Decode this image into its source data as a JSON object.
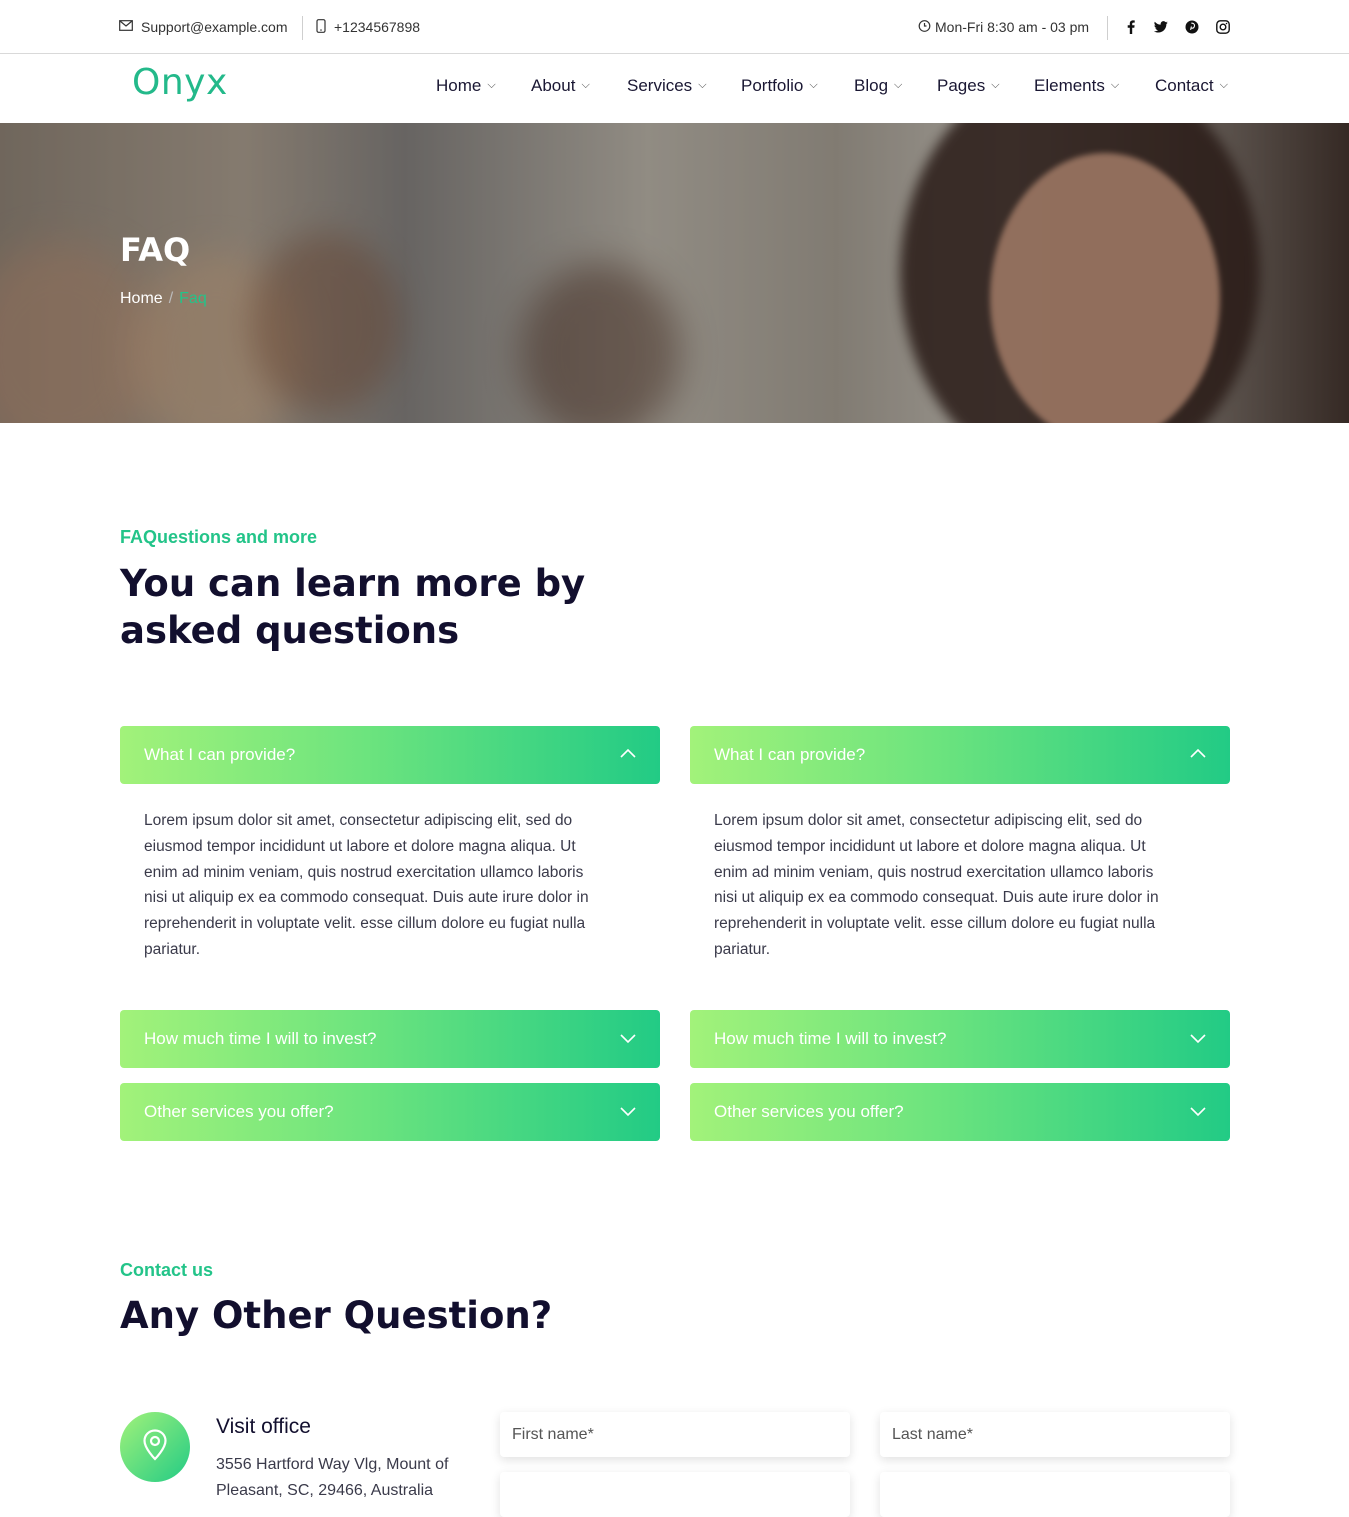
{
  "topbar": {
    "email": "Support@example.com",
    "phone": "+1234567898",
    "hours": "Mon-Fri 8:30 am - 03 pm",
    "social": [
      "facebook-icon",
      "twitter-icon",
      "pinterest-icon",
      "instagram-icon"
    ]
  },
  "header": {
    "logo": "Onyx",
    "nav": [
      "Home",
      "About",
      "Services",
      "Portfolio",
      "Blog",
      "Pages",
      "Elements",
      "Contact"
    ]
  },
  "hero": {
    "title": "FAQ",
    "breadcrumb_home": "Home",
    "breadcrumb_sep": "/",
    "breadcrumb_current": "Faq"
  },
  "faq": {
    "kicker": "FAQuestions and more",
    "heading_line1": "You can learn more by",
    "heading_line2": "asked questions",
    "left": [
      {
        "question": "What I can provide?",
        "open": true
      },
      {
        "question": "How much time I will to invest?",
        "open": false
      },
      {
        "question": "Other services you offer?",
        "open": false
      }
    ],
    "right": [
      {
        "question": "What I can provide?",
        "open": true
      },
      {
        "question": "How much time I will to invest?",
        "open": false
      },
      {
        "question": "Other services you offer?",
        "open": false
      }
    ],
    "answer_lines": [
      "Lorem ipsum dolor sit amet, consectetur adipiscing elit, sed do",
      "eiusmod tempor incididunt ut labore et dolore magna aliqua. Ut",
      "enim ad minim veniam, quis nostrud exercitation ullamco laboris",
      "nisi ut aliquip ex ea commodo consequat. Duis aute irure dolor in",
      "reprehenderit in voluptate velit. esse cillum dolore eu fugiat nulla",
      "pariatur."
    ]
  },
  "contact": {
    "kicker": "Contact us",
    "heading": "Any Other Question?",
    "visit_title": "Visit office",
    "visit_address_line1": "3556 Hartford Way Vlg, Mount of",
    "visit_address_line2": "Pleasant, SC, 29466, Australia",
    "first_name_placeholder": "First name*",
    "last_name_placeholder": "Last name*"
  },
  "colors": {
    "accent": "#23c489",
    "heading": "#120f2e",
    "gradient_start": "#a2f27a",
    "gradient_end": "#22cb85"
  }
}
